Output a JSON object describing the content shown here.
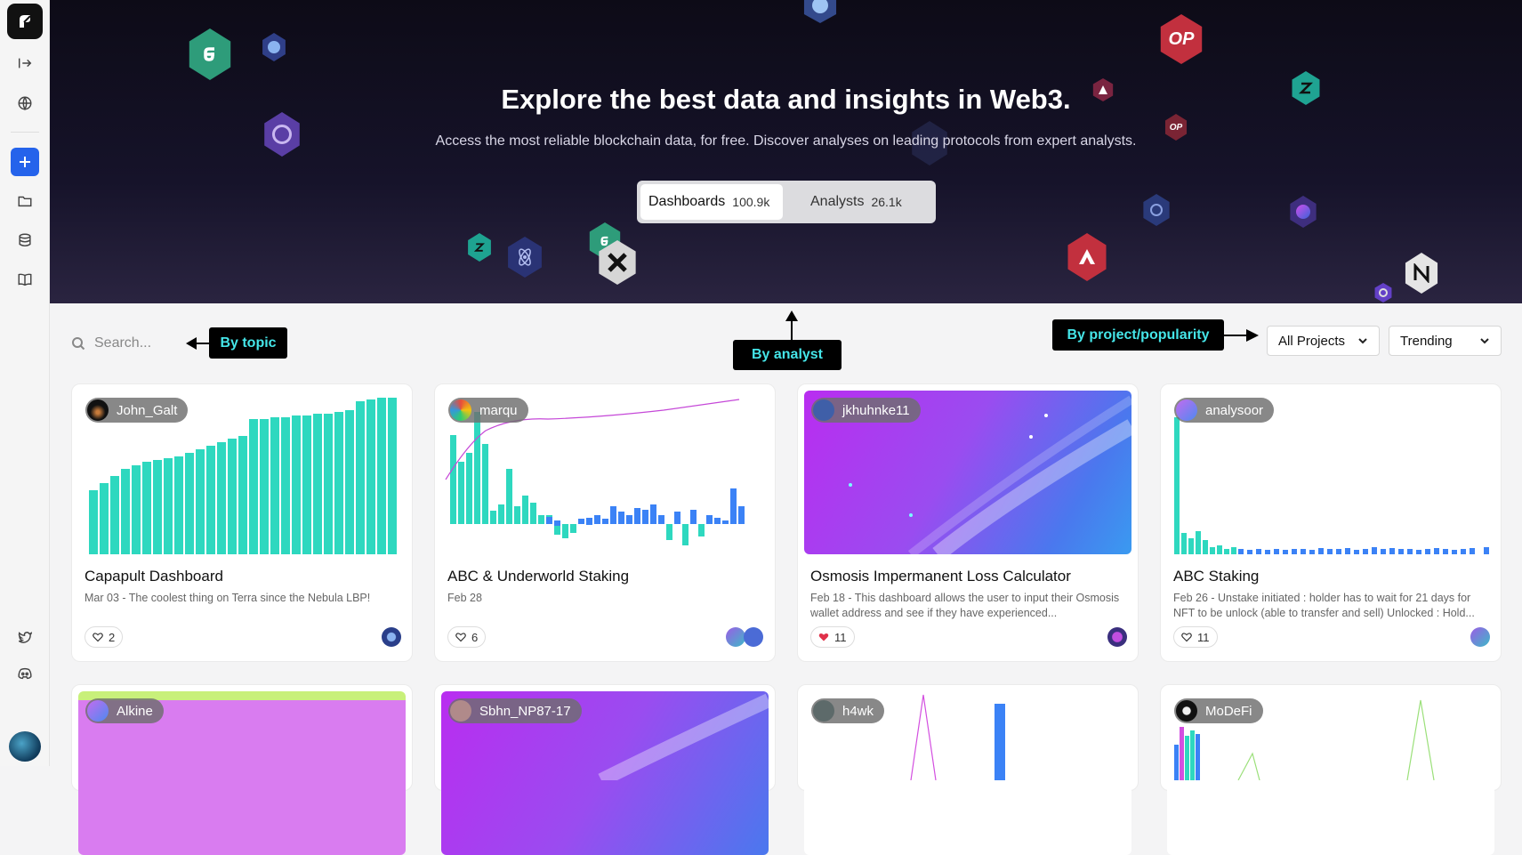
{
  "sidebar": {
    "items": [
      {
        "name": "collapse-icon"
      },
      {
        "name": "globe-icon"
      },
      {
        "name": "plus-icon"
      },
      {
        "name": "folder-icon"
      },
      {
        "name": "database-icon"
      },
      {
        "name": "book-icon"
      },
      {
        "name": "twitter-icon"
      },
      {
        "name": "discord-icon"
      }
    ]
  },
  "hero": {
    "title": "Explore the best data and insights in Web3.",
    "subtitle": "Access the most reliable blockchain data, for free. Discover analyses on leading protocols from expert analysts.",
    "toggle": {
      "dashboards_label": "Dashboards",
      "dashboards_count": "100.9k",
      "analysts_label": "Analysts",
      "analysts_count": "26.1k"
    },
    "token_labels": {
      "op": "OP"
    }
  },
  "toolbar": {
    "search_placeholder": "Search...",
    "project_filter": "All Projects",
    "sort": "Trending"
  },
  "callouts": {
    "topic": "By topic",
    "analyst": "By analyst",
    "project": "By project/popularity"
  },
  "cards": [
    {
      "author": "John_Galt",
      "title": "Capapult Dashboard",
      "desc": "Mar 03 - The coolest thing on Terra since the Nebula LBP!",
      "likes": "2",
      "liked": false
    },
    {
      "author": "marqu",
      "title": "ABC & Underworld Staking",
      "desc": "Feb 28",
      "likes": "6",
      "liked": false
    },
    {
      "author": "jkhuhnke11",
      "title": "Osmosis Impermanent Loss Calculator",
      "desc": "Feb 18 - This dashboard allows the user to input their Osmosis wallet address and see if they have experienced...",
      "likes": "11",
      "liked": true
    },
    {
      "author": "analysoor",
      "title": "ABC Staking",
      "desc": "Feb 26 - Unstake initiated : holder has to wait for 21 days for NFT to be unlock (able to transfer and sell) Unlocked : Hold...",
      "likes": "11",
      "liked": false
    },
    {
      "author": "Alkine"
    },
    {
      "author": "Sbhn_NP87-17"
    },
    {
      "author": "h4wk"
    },
    {
      "author": "MoDeFi"
    }
  ],
  "colors": {
    "accent": "#2563eb",
    "teal": "#2bdcc0",
    "callout_text": "#45e5e8"
  }
}
